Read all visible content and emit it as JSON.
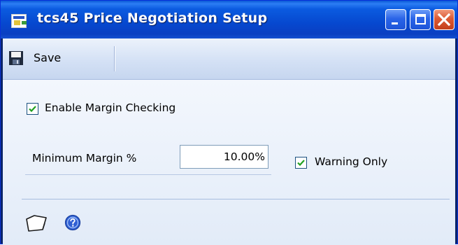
{
  "window": {
    "title": "tcs45 Price Negotiation Setup",
    "icons": {
      "app": "window-form-icon",
      "minimize": "minimize-icon",
      "maximize": "maximize-icon",
      "close": "close-icon"
    }
  },
  "toolbar": {
    "save_label": "Save",
    "save_icon": "floppy-disk-icon"
  },
  "form": {
    "enable_margin_checking": {
      "label": "Enable Margin Checking",
      "checked": true
    },
    "minimum_margin": {
      "label": "Minimum Margin %",
      "value": "10.00%"
    },
    "warning_only": {
      "label": "Warning Only",
      "checked": true
    }
  },
  "footer": {
    "note_icon": "note-icon",
    "help_icon": "help-icon"
  },
  "colors": {
    "titlebar": "#0648cf",
    "close_button": "#dd5a34",
    "checkmark": "#21a121",
    "form_background": "#e9f0fa"
  }
}
